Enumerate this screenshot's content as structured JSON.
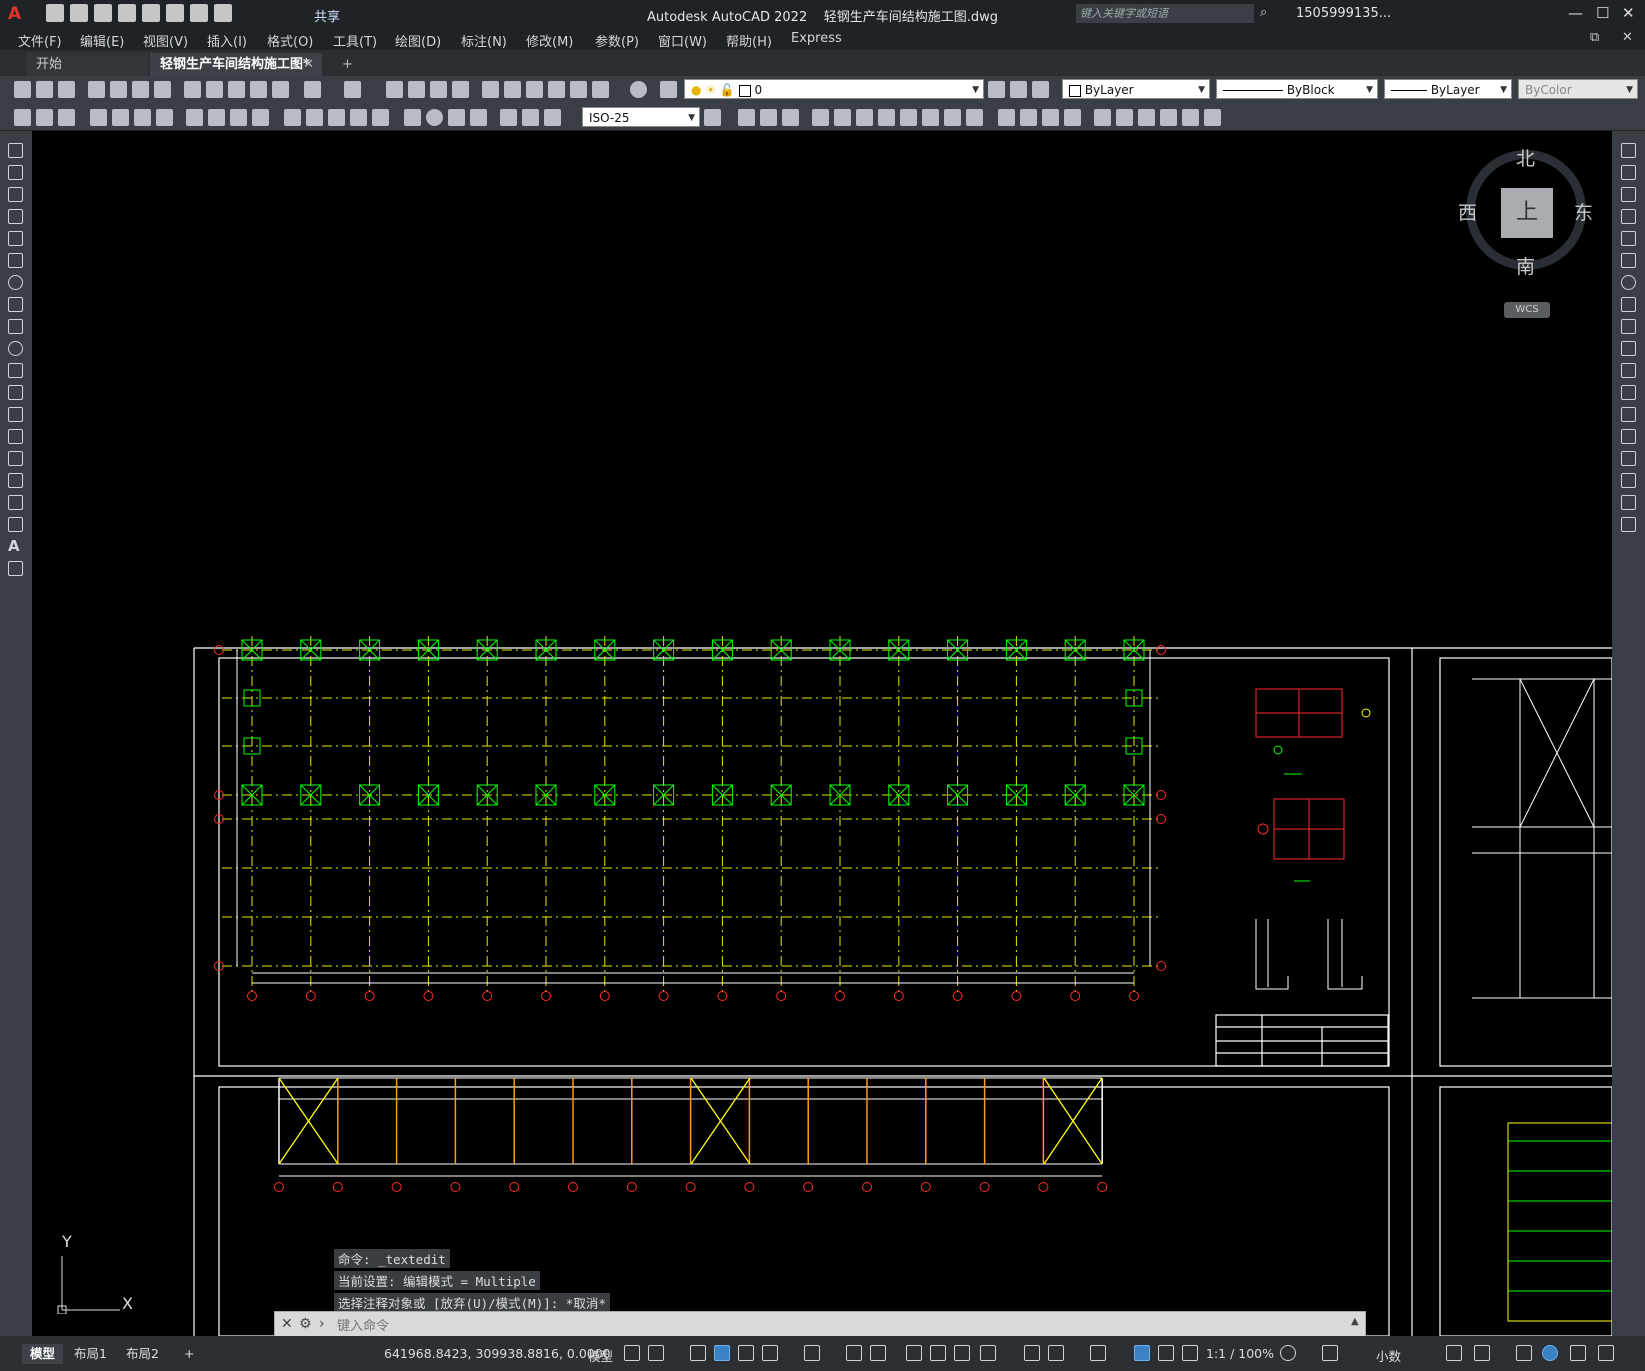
{
  "title_bar": {
    "app_title": "Autodesk AutoCAD 2022",
    "file_title": "轻钢生产车间结构施工图.dwg",
    "share_label": "共享",
    "search_placeholder": "键入关键字或短语",
    "user_label": "1505999135...",
    "accent_color": "#e0332e"
  },
  "menu": {
    "items": [
      "文件(F)",
      "编辑(E)",
      "视图(V)",
      "插入(I)",
      "格式(O)",
      "工具(T)",
      "绘图(D)",
      "标注(N)",
      "修改(M)",
      "参数(P)",
      "窗口(W)",
      "帮助(H)",
      "Express"
    ]
  },
  "tabs": {
    "start_label": "开始",
    "file_label": "轻钢生产车间结构施工图*",
    "close_glyph": "✕",
    "add_glyph": "+"
  },
  "toolbar": {
    "layer_value": "0",
    "color_value": "ByLayer",
    "linetype_value": "ByBlock",
    "lineweight_value": "ByLayer",
    "plotstyle_value": "ByColor",
    "dimstyle_value": "ISO-25"
  },
  "viewcube": {
    "north": "北",
    "south": "南",
    "east": "东",
    "west": "西",
    "face": "上",
    "wcs_label": "WCS"
  },
  "ucs": {
    "x_label": "X",
    "y_label": "Y"
  },
  "command": {
    "history": [
      "命令: _textedit",
      "当前设置: 编辑模式 = Multiple",
      "选择注释对象或 [放弃(U)/模式(M)]: *取消*"
    ],
    "placeholder": "键入命令"
  },
  "status": {
    "layout_tabs": [
      "模型",
      "布局1",
      "布局2"
    ],
    "coords": "641968.8423, 309938.8816, 0.0000",
    "model_label": "模型",
    "scale_label": "1:1 / 100%",
    "units_label": "小数"
  }
}
